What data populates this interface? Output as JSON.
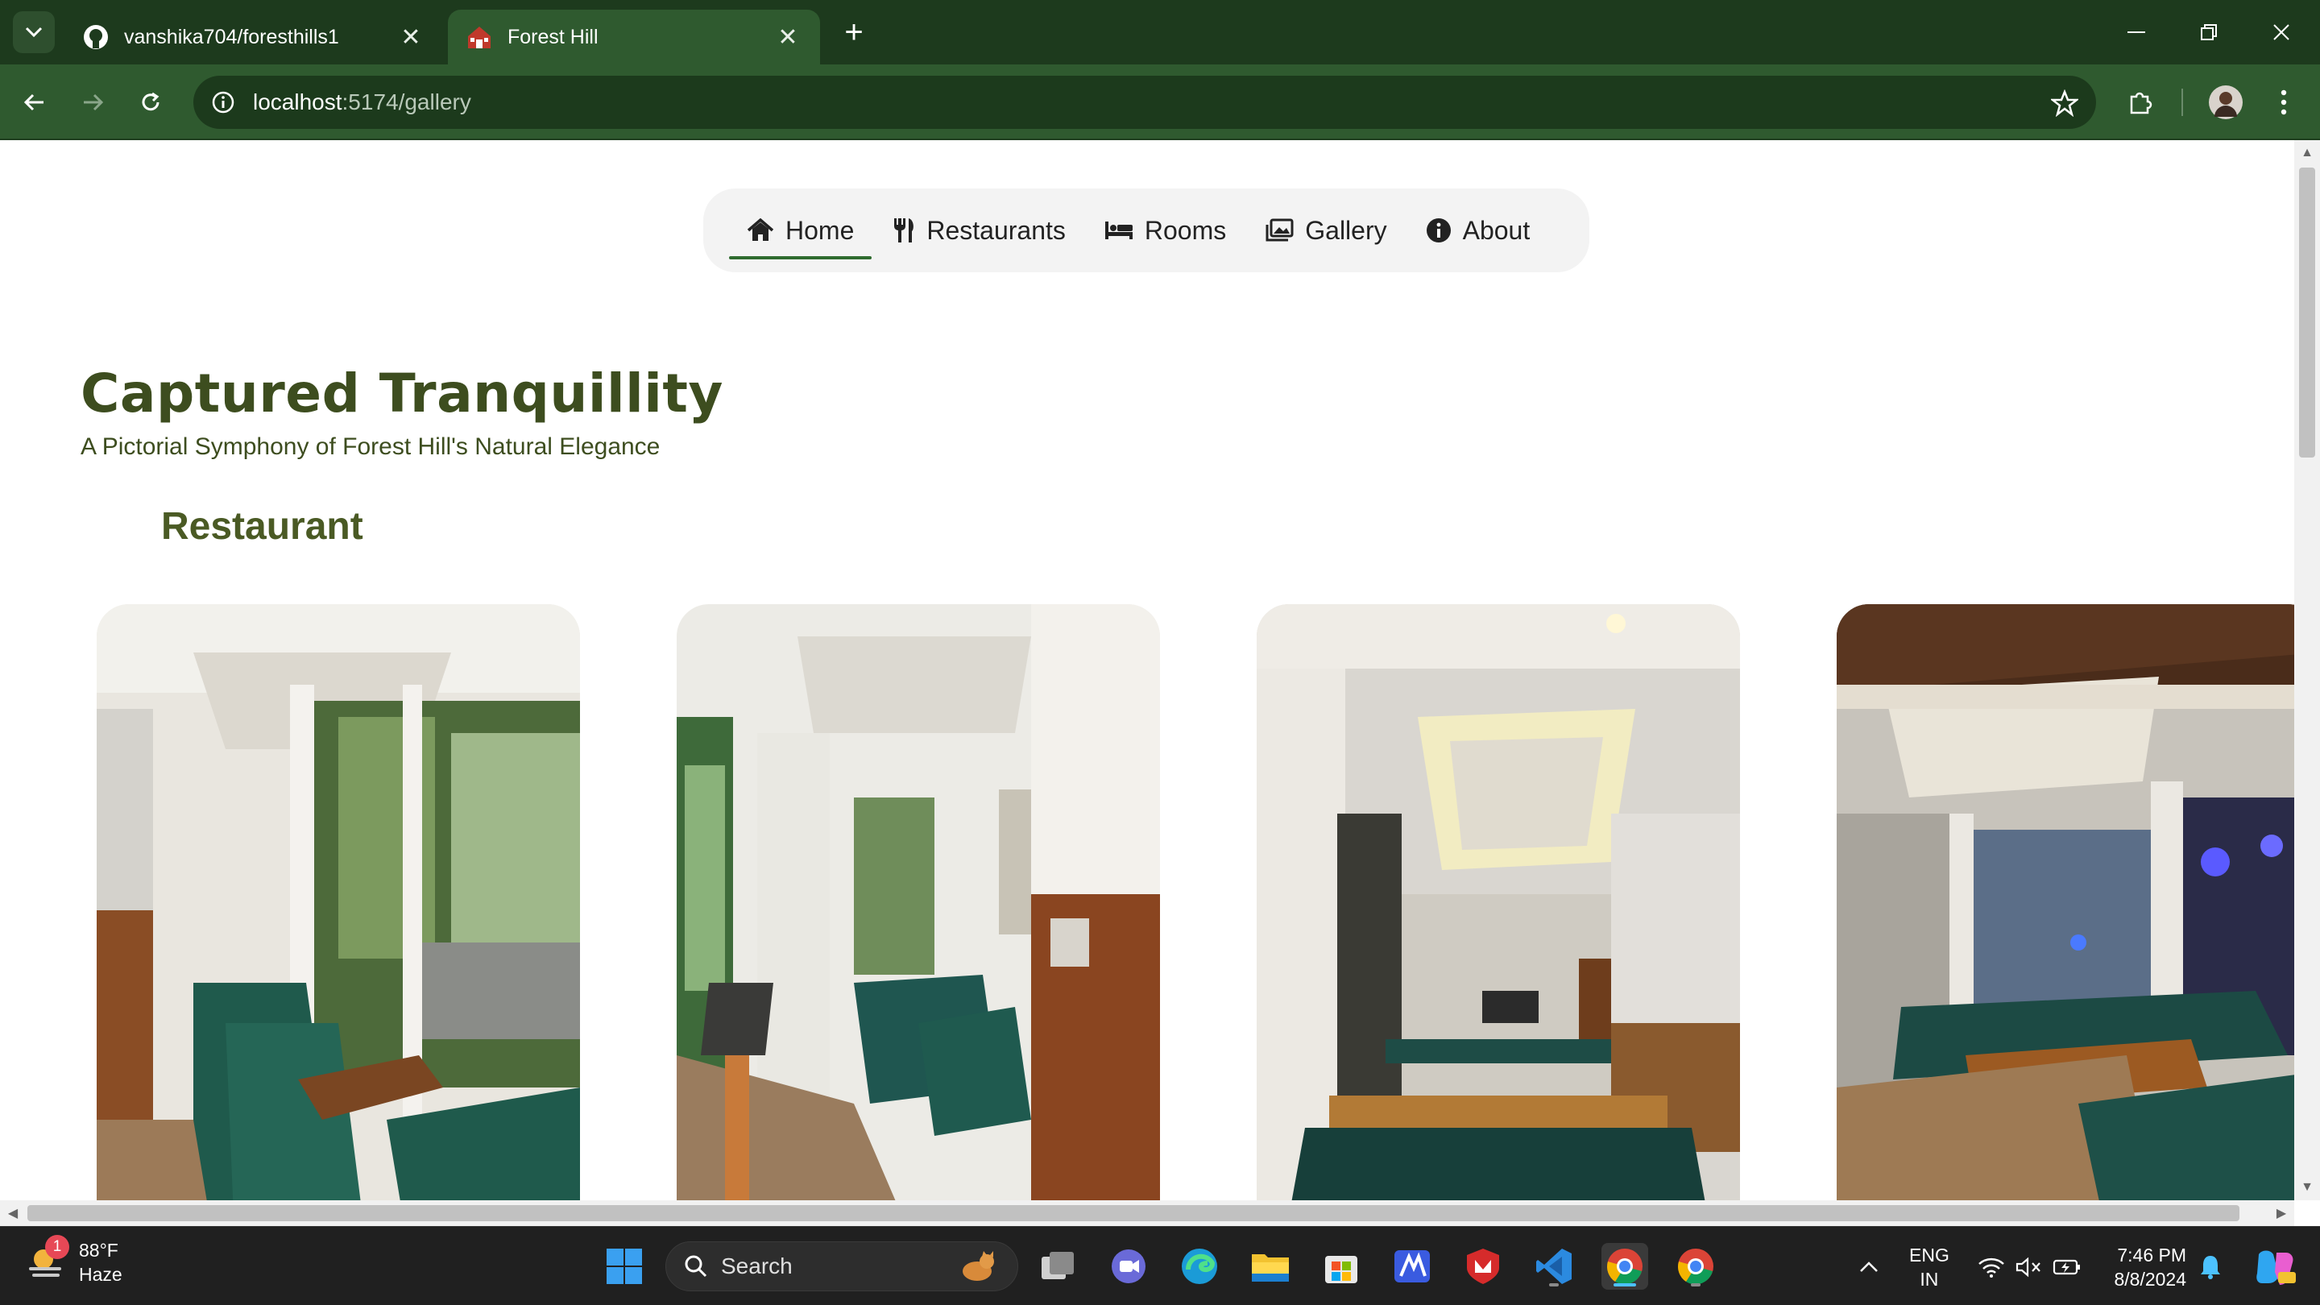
{
  "browser": {
    "tabs": [
      {
        "title": "vanshika704/foresthills1",
        "favicon": "github-icon",
        "active": false
      },
      {
        "title": "Forest Hill",
        "favicon": "house-icon",
        "active": true
      }
    ],
    "address": {
      "host": "localhost",
      "path": ":5174/gallery"
    }
  },
  "site_nav": {
    "items": [
      {
        "label": "Home",
        "icon": "home-icon",
        "active": true
      },
      {
        "label": "Restaurants",
        "icon": "utensils-icon",
        "active": false
      },
      {
        "label": "Rooms",
        "icon": "bed-icon",
        "active": false
      },
      {
        "label": "Gallery",
        "icon": "images-icon",
        "active": false
      },
      {
        "label": "About",
        "icon": "info-icon",
        "active": false
      }
    ]
  },
  "page": {
    "title": "Captured Tranquillity",
    "subtitle": "A Pictorial Symphony of Forest Hill's Natural Elegance",
    "section": "Restaurant"
  },
  "taskbar": {
    "weather": {
      "temp": "88°F",
      "condition": "Haze",
      "badge": "1"
    },
    "search_placeholder": "Search",
    "lang": {
      "line1": "ENG",
      "line2": "IN"
    },
    "clock": {
      "time": "7:46 PM",
      "date": "8/8/2024"
    }
  },
  "colors": {
    "chrome_dark": "#1d3a1d",
    "chrome_toolbar": "#2f5a2f",
    "heading": "#3d4d1f",
    "nav_active_underline": "#2e6b2e"
  }
}
